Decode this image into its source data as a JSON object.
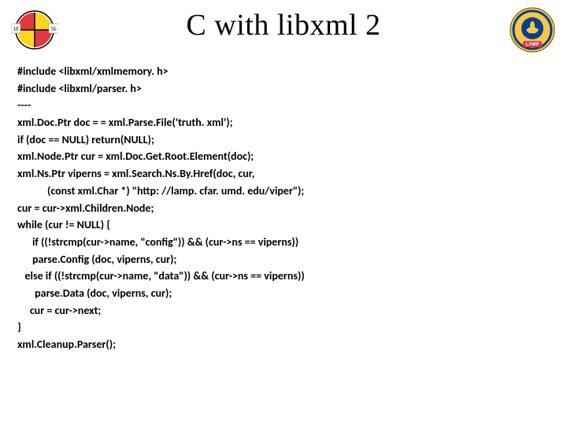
{
  "title": "C with libxml 2",
  "code_lines": [
    "#include <libxml/xmlmemory. h>",
    "#include <libxml/parser. h>",
    "----",
    "xml.Doc.Ptr doc = = xml.Parse.File('truth. xml');",
    "if (doc == NULL) return(NULL);",
    "xml.Node.Ptr cur = xml.Doc.Get.Root.Element(doc);",
    "xml.Ns.Ptr viperns = xml.Search.Ns.By.Href(doc, cur,",
    "            (const xml.Char *) \"http: //lamp. cfar. umd. edu/viper\");",
    "cur = cur->xml.Children.Node;",
    "while (cur != NULL) {",
    "      if ((!strcmp(cur->name, \"config\")) && (cur->ns == viperns))",
    "      parse.Config (doc, viperns, cur);",
    "   else if ((!strcmp(cur->name, \"data\")) && (cur->ns == viperns))",
    "       parse.Data (doc, viperns, cur);",
    "     cur = cur->next;",
    "}",
    "xml.Cleanup.Parser();"
  ],
  "logos": {
    "left": {
      "name": "university-of-maryland-seal",
      "year_left": "18",
      "year_right": "56"
    },
    "right": {
      "name": "lamp-seal",
      "label": "LAMP"
    }
  },
  "colors": {
    "md_red": "#E03A3E",
    "md_gold": "#FFD520",
    "md_black": "#000000",
    "lamp_bg": "#F5C945",
    "lamp_ring": "#0B3D91"
  }
}
